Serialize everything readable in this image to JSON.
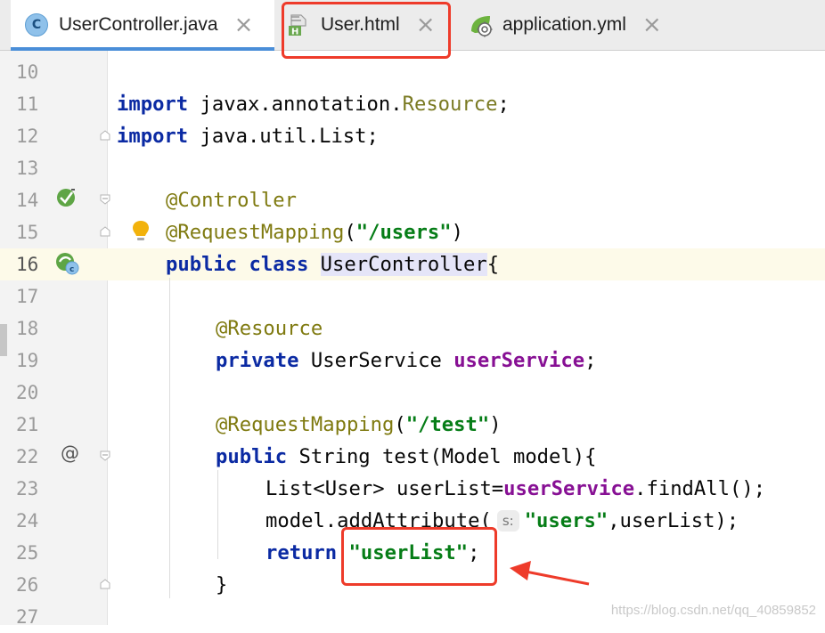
{
  "tabs": [
    {
      "label": "UserController.java",
      "icon": "java-class-icon",
      "icon_letter": "C",
      "close": "×",
      "active": true
    },
    {
      "label": "User.html",
      "icon": "html-file-icon",
      "icon_letter": "H",
      "close": "×",
      "active": false
    },
    {
      "label": "application.yml",
      "icon": "spring-yml-icon",
      "close": "×",
      "active": false
    }
  ],
  "gutter_icons": {
    "line22_symbol": "@",
    "line16_badge": "c"
  },
  "line_numbers": [
    "10",
    "11",
    "12",
    "13",
    "14",
    "15",
    "16",
    "17",
    "18",
    "19",
    "20",
    "21",
    "22",
    "23",
    "24",
    "25",
    "26",
    "27"
  ],
  "code": {
    "l11": {
      "kw": "import",
      "pkg": "javax.annotation.",
      "cls": "Resource",
      "end": ";"
    },
    "l12": {
      "kw": "import",
      "rest": "java.util.List;"
    },
    "l14": {
      "ann": "@Controller"
    },
    "l15": {
      "ann": "@RequestMapping",
      "open": "(",
      "str": "\"/users\"",
      "close": ")"
    },
    "l16": {
      "kw1": "public",
      "kw2": "class",
      "name": "UserController",
      "brace": "{"
    },
    "l18": {
      "ann": "@Resource"
    },
    "l19": {
      "kw": "private",
      "type": "UserService",
      "field": "userService",
      "end": ";"
    },
    "l21": {
      "ann": "@RequestMapping",
      "open": "(",
      "str": "\"/test\"",
      "close": ")"
    },
    "l22": {
      "kw": "public",
      "rest": "String test(Model model){"
    },
    "l23": {
      "pre": "List<User> userList=",
      "field": "userService",
      "post": ".findAll();"
    },
    "l24": {
      "pre": "model.addAttribute(",
      "hint": "s:",
      "str": "\"users\"",
      "post": ",userList);"
    },
    "l25": {
      "kw": "return",
      "str": "\"userList\"",
      "end": ";"
    },
    "l26": {
      "brace": "}"
    }
  },
  "watermark": "https://blog.csdn.net/qq_40859852",
  "colors": {
    "annotation_red": "#ee3b2a",
    "keyword": "#0b2aa3",
    "string": "#067d17",
    "field": "#871094",
    "annotation": "#7f7a10"
  }
}
